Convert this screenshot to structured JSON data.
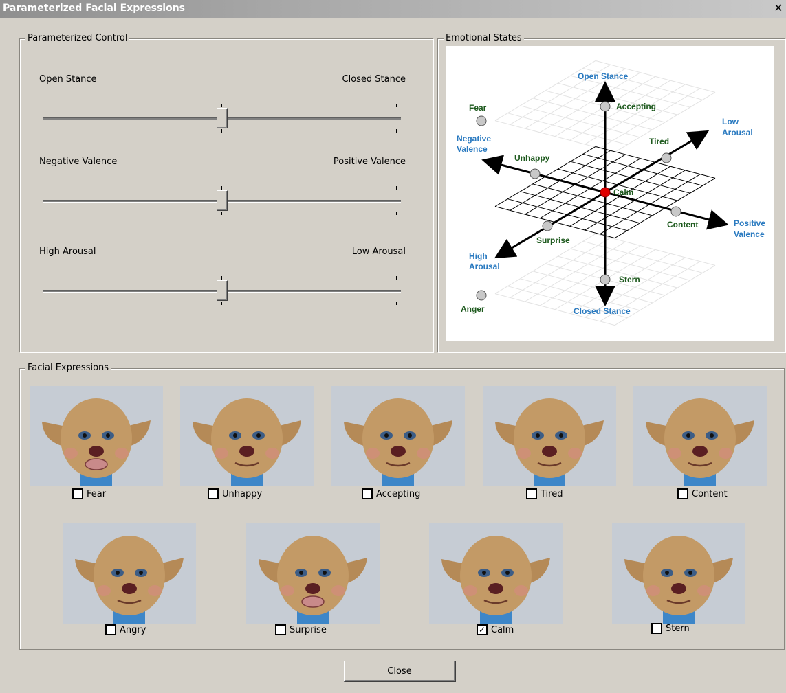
{
  "window": {
    "title": "Parameterized Facial Expressions",
    "close_glyph": "✕"
  },
  "control": {
    "legend": "Parameterized Control",
    "sliders": [
      {
        "left_label": "Open Stance",
        "right_label": "Closed Stance",
        "value": 0.5
      },
      {
        "left_label": "Negative Valence",
        "right_label": "Positive Valence",
        "value": 0.5
      },
      {
        "left_label": "High Arousal",
        "right_label": "Low Arousal",
        "value": 0.5
      }
    ]
  },
  "emotional_states": {
    "legend": "Emotional States",
    "axis_labels": {
      "open": "Open Stance",
      "closed": "Closed Stance",
      "negative": [
        "Negative",
        "Valence"
      ],
      "positive": [
        "Positive",
        "Valence"
      ],
      "high": [
        "High",
        "Arousal"
      ],
      "low": [
        "Low",
        "Arousal"
      ]
    },
    "states": [
      "Fear",
      "Accepting",
      "Unhappy",
      "Tired",
      "Calm",
      "Content",
      "Surprise",
      "Stern",
      "Anger"
    ]
  },
  "expressions": {
    "legend": "Facial Expressions",
    "items": [
      {
        "label": "Fear",
        "checked": false
      },
      {
        "label": "Unhappy",
        "checked": false
      },
      {
        "label": "Accepting",
        "checked": false
      },
      {
        "label": "Tired",
        "checked": false
      },
      {
        "label": "Content",
        "checked": false
      },
      {
        "label": "Angry",
        "checked": false
      },
      {
        "label": "Surprise",
        "checked": false
      },
      {
        "label": "Calm",
        "checked": true
      },
      {
        "label": "Stern",
        "checked": false
      }
    ]
  },
  "close_button": {
    "label": "Close"
  },
  "colors": {
    "axis_label": "#2a7ac0",
    "state_label": "#1e5a1e",
    "center_point": "#e00000"
  }
}
